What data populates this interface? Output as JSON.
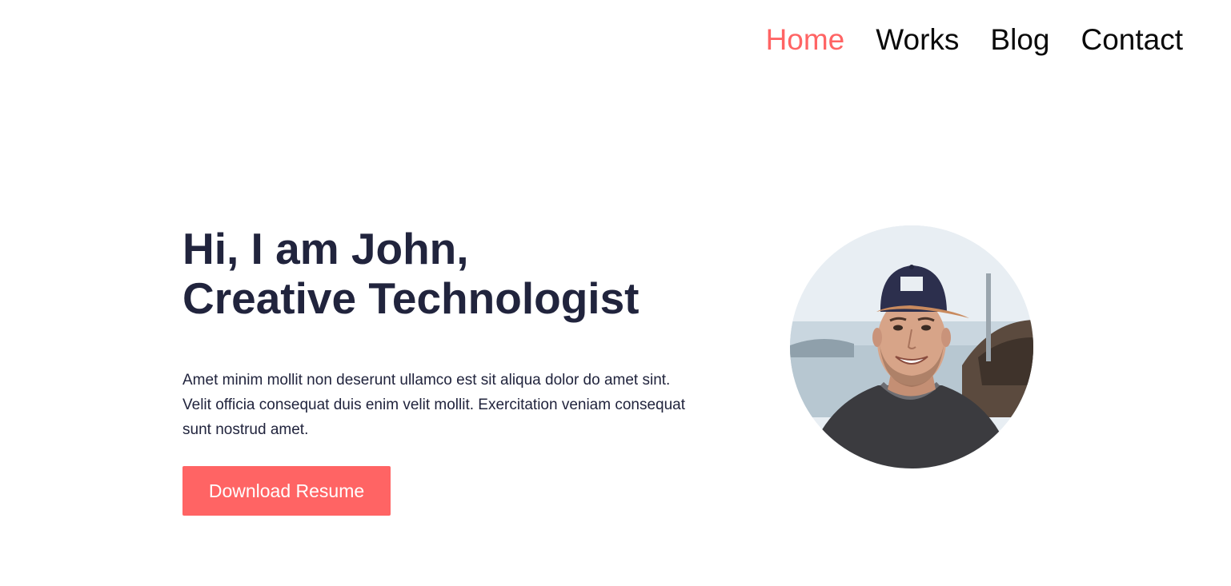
{
  "nav": {
    "items": [
      {
        "label": "Home",
        "active": true
      },
      {
        "label": "Works",
        "active": false
      },
      {
        "label": "Blog",
        "active": false
      },
      {
        "label": "Contact",
        "active": false
      }
    ]
  },
  "hero": {
    "title_line1": "Hi, I am John,",
    "title_line2": "Creative Technologist",
    "description": "Amet minim mollit non deserunt ullamco est sit aliqua dolor do amet sint. Velit officia consequat duis enim velit mollit. Exercitation veniam consequat sunt nostrud amet.",
    "cta_label": "Download Resume"
  },
  "colors": {
    "accent": "#ff6464",
    "heading": "#21243d",
    "nav_text": "#0a0a0a",
    "background": "#ffffff"
  }
}
